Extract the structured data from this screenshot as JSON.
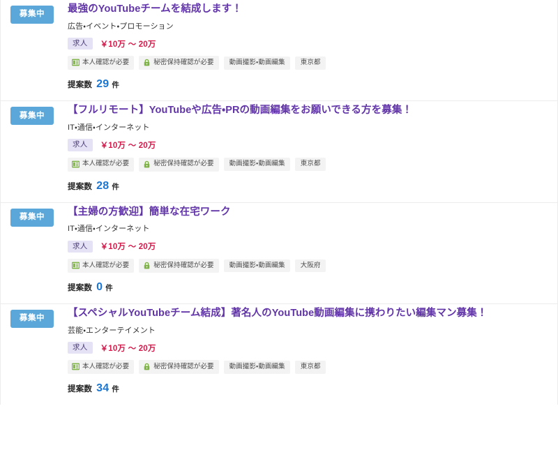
{
  "colors": {
    "badge_bg": "#5ba7d9",
    "title": "#6135a8",
    "price": "#d21a4a",
    "count": "#1a76d2",
    "type_chip_bg": "#e6e2f5",
    "type_chip_text": "#4a3b7a",
    "tag_bg": "#f3f3f3",
    "icon_green": "#7cb342",
    "divider": "#ececec"
  },
  "labels": {
    "proposal_label": "提案数",
    "proposal_unit": "件"
  },
  "jobs": [
    {
      "status": "募集中",
      "title": "最強のYouTubeチームを結成します！",
      "category": "広告・イベント・プロモーション",
      "type": "求人",
      "price": "￥10万 〜 20万",
      "tags": [
        {
          "icon": "id-card-icon",
          "label": "本人確認が必要"
        },
        {
          "icon": "lock-icon",
          "label": "秘密保持確認が必要"
        },
        {
          "icon": "",
          "label": "動画撮影・動画編集"
        },
        {
          "icon": "",
          "label": "東京都"
        }
      ],
      "proposal_count": "29"
    },
    {
      "status": "募集中",
      "title": "【フルリモート】YouTubeや広告・PRの動画編集をお願いできる方を募集！",
      "category": "IT・通信・インターネット",
      "type": "求人",
      "price": "￥10万 〜 20万",
      "tags": [
        {
          "icon": "id-card-icon",
          "label": "本人確認が必要"
        },
        {
          "icon": "lock-icon",
          "label": "秘密保持確認が必要"
        },
        {
          "icon": "",
          "label": "動画撮影・動画編集"
        },
        {
          "icon": "",
          "label": "東京都"
        }
      ],
      "proposal_count": "28"
    },
    {
      "status": "募集中",
      "title": "【主婦の方歓迎】簡単な在宅ワーク",
      "category": "IT・通信・インターネット",
      "type": "求人",
      "price": "￥10万 〜 20万",
      "tags": [
        {
          "icon": "id-card-icon",
          "label": "本人確認が必要"
        },
        {
          "icon": "lock-icon",
          "label": "秘密保持確認が必要"
        },
        {
          "icon": "",
          "label": "動画撮影・動画編集"
        },
        {
          "icon": "",
          "label": "大阪府"
        }
      ],
      "proposal_count": "0"
    },
    {
      "status": "募集中",
      "title": "【スペシャルYouTubeチーム結成】著名人のYouTube動画編集に携わりたい編集マン募集！",
      "category": "芸能・エンターテイメント",
      "type": "求人",
      "price": "￥10万 〜 20万",
      "tags": [
        {
          "icon": "id-card-icon",
          "label": "本人確認が必要"
        },
        {
          "icon": "lock-icon",
          "label": "秘密保持確認が必要"
        },
        {
          "icon": "",
          "label": "動画撮影・動画編集"
        },
        {
          "icon": "",
          "label": "東京都"
        }
      ],
      "proposal_count": "34"
    }
  ]
}
